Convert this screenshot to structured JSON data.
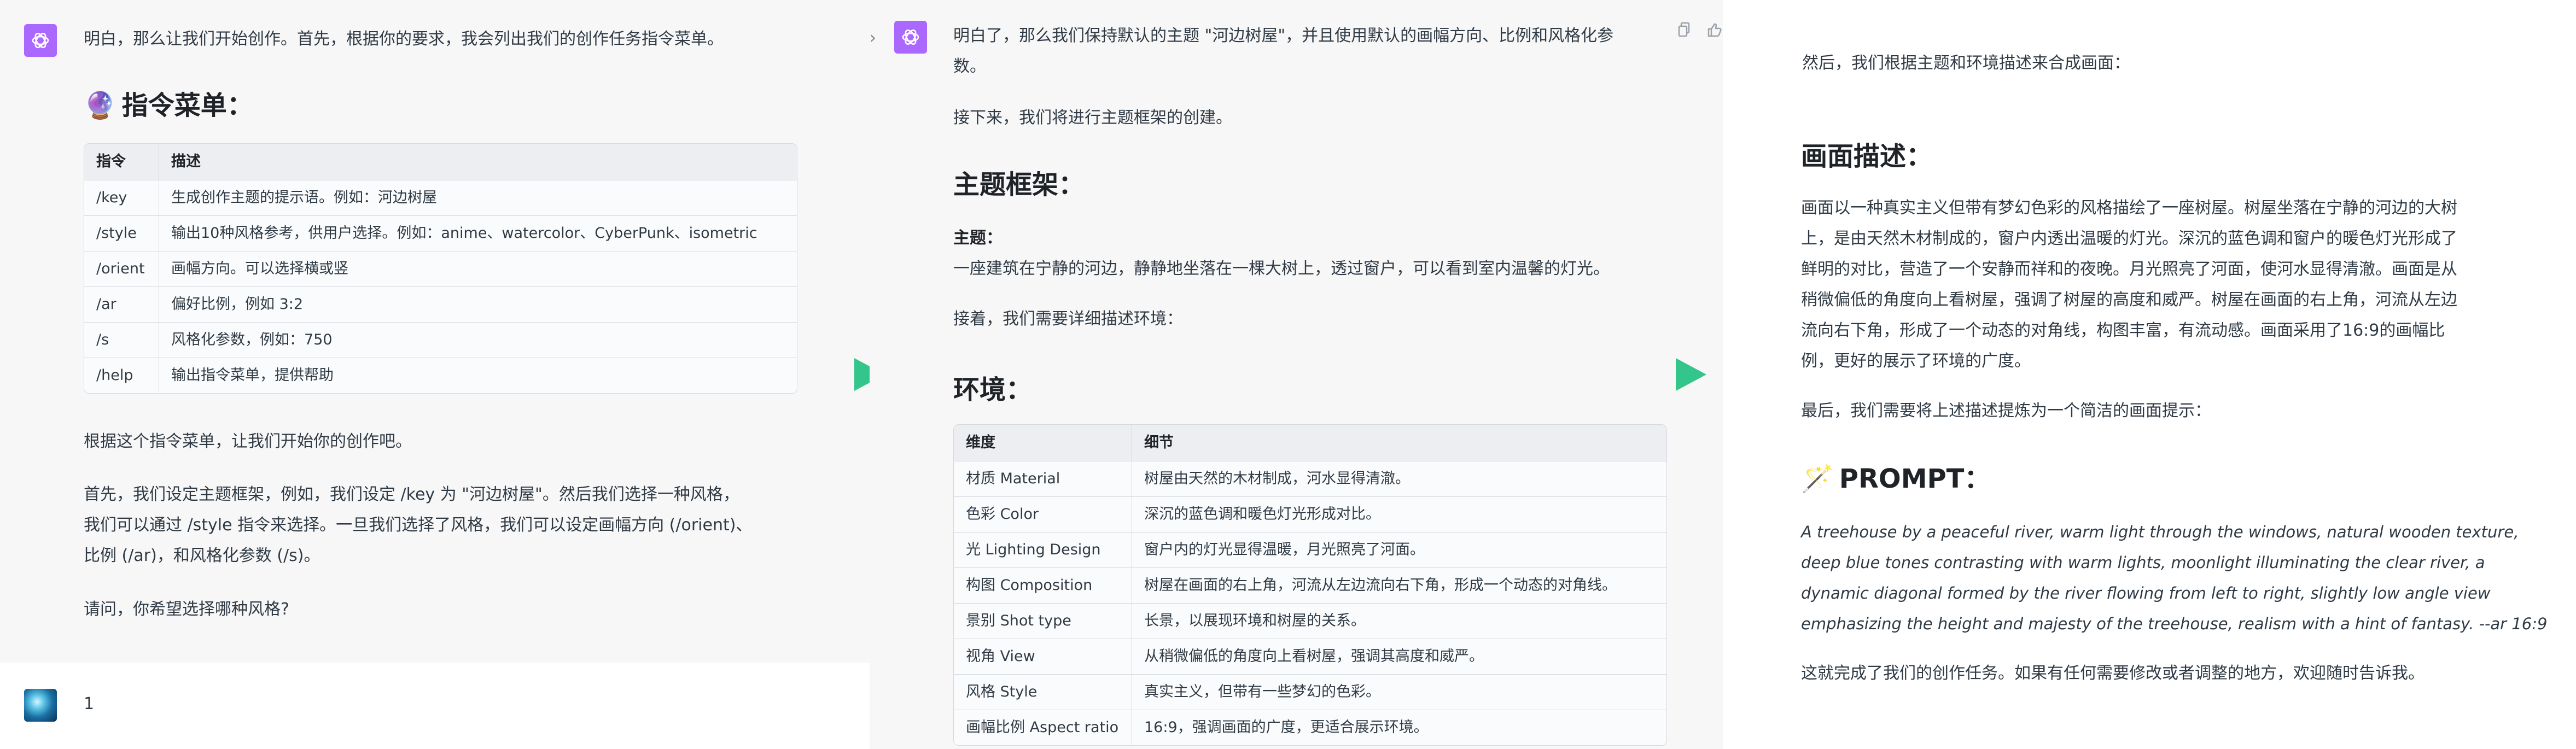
{
  "panel1": {
    "intro": "明白，那么让我们开始创作。首先，根据你的要求，我会列出我们的创作任务指令菜单。",
    "menu_emoji": "🔮",
    "menu_title": "指令菜单：",
    "table": {
      "headers": [
        "指令",
        "描述"
      ],
      "rows": [
        [
          "/key",
          "生成创作主题的提示语。例如：河边树屋"
        ],
        [
          "/style",
          "输出10种风格参考，供用户选择。例如：anime、watercolor、CyberPunk、isometric"
        ],
        [
          "/orient",
          "画幅方向。可以选择横或竖"
        ],
        [
          "/ar",
          "偏好比例，例如 3:2"
        ],
        [
          "/s",
          "风格化参数，例如：750"
        ],
        [
          "/help",
          "输出指令菜单，提供帮助"
        ]
      ]
    },
    "p_start": "根据这个指令菜单，让我们开始你的创作吧。",
    "p_first": [
      "首先，我们设定主题框架，例如，我们设定 /key 为 \"河边树屋\"。然后我们选择一种风格，",
      "我们可以通过 /style 指令来选择。一旦我们选择了风格，我们可以设定画幅方向 (/orient)、",
      "比例 (/ar)，和风格化参数 (/s)。"
    ],
    "p_ask": "请问，你希望选择哪种风格?",
    "user_message": "1"
  },
  "panel2": {
    "intro": [
      "明白了，那么我们保持默认的主题 \"河边树屋\"，并且使用默认的画幅方向、比例和风格化参",
      "数。"
    ],
    "next": "接下来，我们将进行主题框架的创建。",
    "frame_title": "主题框架：",
    "theme_label": "主题：",
    "theme_text": "一座建筑在宁静的河边，静静地坐落在一棵大树上，透过窗户，可以看到室内温馨的灯光。",
    "then": "接着，我们需要详细描述环境：",
    "env_title": "环境：",
    "table": {
      "headers": [
        "维度",
        "细节"
      ],
      "rows": [
        [
          "材质 Material",
          "树屋由天然的木材制成，河水显得清澈。"
        ],
        [
          "色彩 Color",
          "深沉的蓝色调和暖色灯光形成对比。"
        ],
        [
          "光 Lighting Design",
          "窗户内的灯光显得温暖，月光照亮了河面。"
        ],
        [
          "构图 Composition",
          "树屋在画面的右上角，河流从左边流向右下角，形成一个动态的对角线。"
        ],
        [
          "景别 Shot type",
          "长景，以展现环境和树屋的关系。"
        ],
        [
          "视角 View",
          "从稍微偏低的角度向上看树屋，强调其高度和威严。"
        ],
        [
          "风格 Style",
          "真实主义，但带有一些梦幻的色彩。"
        ],
        [
          "画幅比例 Aspect ratio",
          "16:9，强调画面的广度，更适合展示环境。"
        ]
      ]
    }
  },
  "panel3": {
    "intro": "然后，我们根据主题和环境描述来合成画面：",
    "desc_title": "画面描述：",
    "desc_lines": [
      "画面以一种真实主义但带有梦幻色彩的风格描绘了一座树屋。树屋坐落在宁静的河边的大树",
      "上，是由天然木材制成的，窗户内透出温暖的灯光。深沉的蓝色调和窗户的暖色灯光形成了",
      "鲜明的对比，营造了一个安静而祥和的夜晚。月光照亮了河面，使河水显得清澈。画面是从",
      "稍微偏低的角度向上看树屋，强调了树屋的高度和威严。树屋在画面的右上角，河流从左边",
      "流向右下角，形成了一个动态的对角线，构图丰富，有流动感。画面采用了16:9的画幅比",
      "例，更好的展示了环境的广度。"
    ],
    "last": "最后，我们需要将上述描述提炼为一个简洁的画面提示：",
    "prompt_emoji": "🪄",
    "prompt_title": "PROMPT：",
    "prompt_lines": [
      "A treehouse by a peaceful river, warm light through the windows, natural wooden texture,",
      "deep blue tones contrasting with warm lights, moonlight illuminating the clear river, a",
      "dynamic diagonal formed by the river flowing from left to right, slightly low angle view",
      "emphasizing the height and majesty of the treehouse, realism with a hint of fantasy. --ar 16:9"
    ],
    "done": "这就完成了我们的创作任务。如果有任何需要修改或者调整的地方，欢迎随时告诉我。"
  },
  "colors": {
    "assistant_avatar": "#ab68ff",
    "arrow": "#34c58a"
  },
  "icons": [
    "chatgpt-logo-icon",
    "user-avatar-image",
    "chevron-right-icon",
    "copy-icon",
    "thumbs-up-icon",
    "arrow-right-icon"
  ]
}
